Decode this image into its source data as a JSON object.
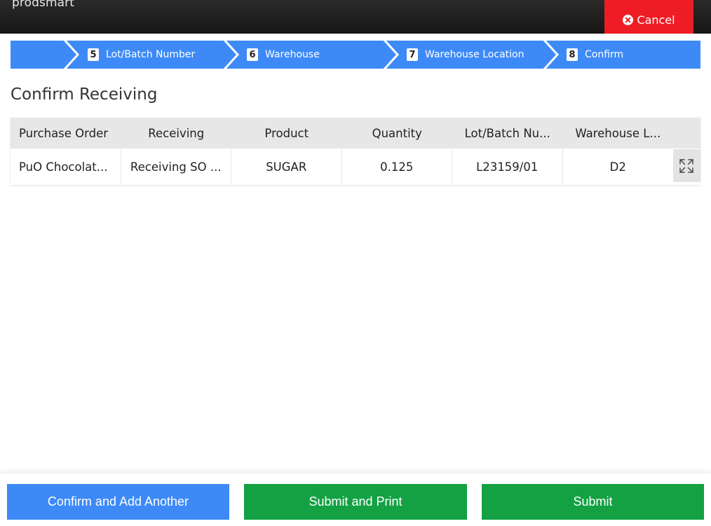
{
  "header": {
    "logo_text": "prodsmart",
    "cancel_label": "Cancel"
  },
  "steps": [
    {
      "number": "5",
      "label": "Lot/Batch Number"
    },
    {
      "number": "6",
      "label": "Warehouse"
    },
    {
      "number": "7",
      "label": "Warehouse Location"
    },
    {
      "number": "8",
      "label": "Confirm"
    }
  ],
  "page": {
    "title": "Confirm Receiving"
  },
  "table": {
    "columns": [
      "Purchase Order",
      "Receiving",
      "Product",
      "Quantity",
      "Lot/Batch Nu...",
      "Warehouse L..."
    ],
    "rows": [
      [
        "PuO Chocolat...",
        "Receiving SO ...",
        "SUGAR",
        "0.125",
        "L23159/01",
        "D2"
      ]
    ]
  },
  "footer": {
    "confirm_add_label": "Confirm and Add Another",
    "submit_print_label": "Submit and Print",
    "submit_label": "Submit"
  },
  "colors": {
    "brand_blue": "#3d8af7",
    "cancel_red": "#ee1c25",
    "submit_green": "#13a143"
  },
  "icons": {
    "cancel": "times-circle-icon",
    "expand": "expand-arrows-icon"
  }
}
